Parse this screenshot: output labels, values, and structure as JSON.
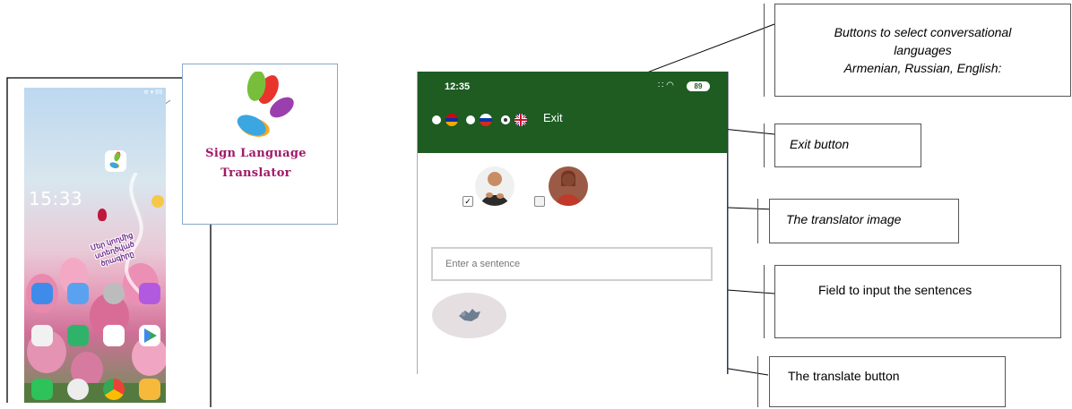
{
  "phone_home": {
    "time": "15:33",
    "status": "≅ ▾ 69",
    "widget_text": "Մեր կողմից ստեղծված ծրագիրը"
  },
  "logo": {
    "line1": "Sign Language",
    "line2": "Translator",
    "petal_colors": [
      "#e8342c",
      "#f6a81c",
      "#3ba6e0",
      "#9b3fae",
      "#77bf3a"
    ]
  },
  "app": {
    "time": "12:35",
    "battery": "89",
    "exit_label": "Exit",
    "languages": [
      "Armenian",
      "Russian",
      "English"
    ],
    "selected_language": "English",
    "translators": [
      {
        "name": "male-translator",
        "checked": true
      },
      {
        "name": "female-translator",
        "checked": false
      }
    ],
    "input_placeholder": "Enter a sentence",
    "header_color": "#1e5c22"
  },
  "callouts": {
    "languages_line1": "Buttons to select conversational",
    "languages_line2": "languages",
    "languages_line3": "Armenian, Russian, English:",
    "exit": "Exit button",
    "translator_image": "The translator image",
    "input_field": "Field to input the sentences",
    "translate": "The translate button"
  }
}
